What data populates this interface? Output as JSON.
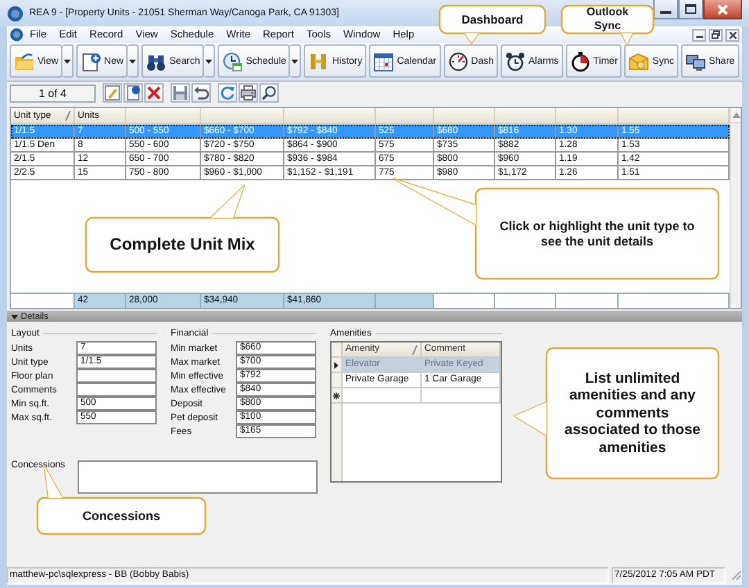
{
  "window": {
    "title": "REA 9 - [Property Units - 21051 Sherman Way/Canoga Park, CA 91303]"
  },
  "menu": [
    "File",
    "Edit",
    "Record",
    "View",
    "Schedule",
    "Write",
    "Report",
    "Tools",
    "Window",
    "Help"
  ],
  "toolbar": [
    {
      "label": "View",
      "dropdown": true
    },
    {
      "label": "New",
      "dropdown": true
    },
    {
      "label": "Search",
      "dropdown": true
    },
    {
      "label": "Schedule",
      "dropdown": true
    },
    {
      "label": "History",
      "dropdown": false
    },
    {
      "label": "Calendar",
      "dropdown": false
    },
    {
      "label": "Dash",
      "dropdown": false
    },
    {
      "label": "Alarms",
      "dropdown": false
    },
    {
      "label": "Timer",
      "dropdown": false
    },
    {
      "label": "Sync",
      "dropdown": false
    },
    {
      "label": "Share",
      "dropdown": false
    }
  ],
  "navigator": {
    "position": "1 of 4"
  },
  "unit_grid": {
    "columns": [
      "Unit type",
      "Units"
    ],
    "rows": [
      {
        "selected": true,
        "cells": [
          "1/1.5",
          "7",
          "500 - 550",
          "$660 - $700",
          "$792 - $840",
          "525",
          "$680",
          "$816",
          "1.30",
          "1.55"
        ]
      },
      {
        "selected": false,
        "cells": [
          "1/1.5 Den",
          "8",
          "550 - 600",
          "$720 - $750",
          "$864 - $900",
          "575",
          "$735",
          "$882",
          "1.28",
          "1.53"
        ]
      },
      {
        "selected": false,
        "cells": [
          "2/1.5",
          "12",
          "650 - 700",
          "$780 - $820",
          "$936 - $984",
          "675",
          "$800",
          "$960",
          "1.19",
          "1.42"
        ]
      },
      {
        "selected": false,
        "cells": [
          "2/2.5",
          "15",
          "750 - 800",
          "$960 - $1,000",
          "$1,152 - $1,191",
          "775",
          "$980",
          "$1,172",
          "1.26",
          "1.51"
        ]
      }
    ],
    "totals": [
      "42",
      "28,000",
      "$34,940",
      "$41,860"
    ]
  },
  "details": {
    "title": "Details",
    "expanded": true,
    "layout": {
      "title": "Layout",
      "fields": [
        {
          "label": "Units",
          "value": "7"
        },
        {
          "label": "Unit type",
          "value": "1/1.5"
        },
        {
          "label": "Floor plan"
        },
        {
          "label": "Comments"
        },
        {
          "label": "Min sq.ft.",
          "value": "500"
        },
        {
          "label": "Max sq.ft.",
          "value": "550"
        }
      ]
    },
    "financial": {
      "title": "Financial",
      "fields": [
        {
          "label": "Min market",
          "value": "$660"
        },
        {
          "label": "Max market",
          "value": "$700"
        },
        {
          "label": "Min effective",
          "value": "$792"
        },
        {
          "label": "Max effective",
          "value": "$840"
        },
        {
          "label": "Deposit",
          "value": "$800"
        },
        {
          "label": "Pet deposit",
          "value": "$100"
        },
        {
          "label": "Fees",
          "value": "$165"
        }
      ]
    },
    "concessions": {
      "label": "Concessions"
    },
    "amenities": {
      "title": "Amenities",
      "columns": [
        "Amenity",
        "Comment"
      ],
      "rows": [
        {
          "selected": true,
          "cells": [
            "Elevator",
            "Private Keyed"
          ]
        },
        {
          "selected": false,
          "cells": [
            "Private Garage",
            "1 Car Garage"
          ]
        }
      ]
    }
  },
  "status_bar": [
    "matthew-pc\\sqlexpress - BB (Bobby Babis)",
    "7/25/2012 7:05 AM PDT"
  ],
  "callouts": [
    "Dashboard",
    "Outlook Sync",
    "Complete Unit Mix",
    "Click or highlight the unit type to see the unit details",
    "List unlimited amenities and any comments associated to those amenities",
    "Concessions"
  ]
}
